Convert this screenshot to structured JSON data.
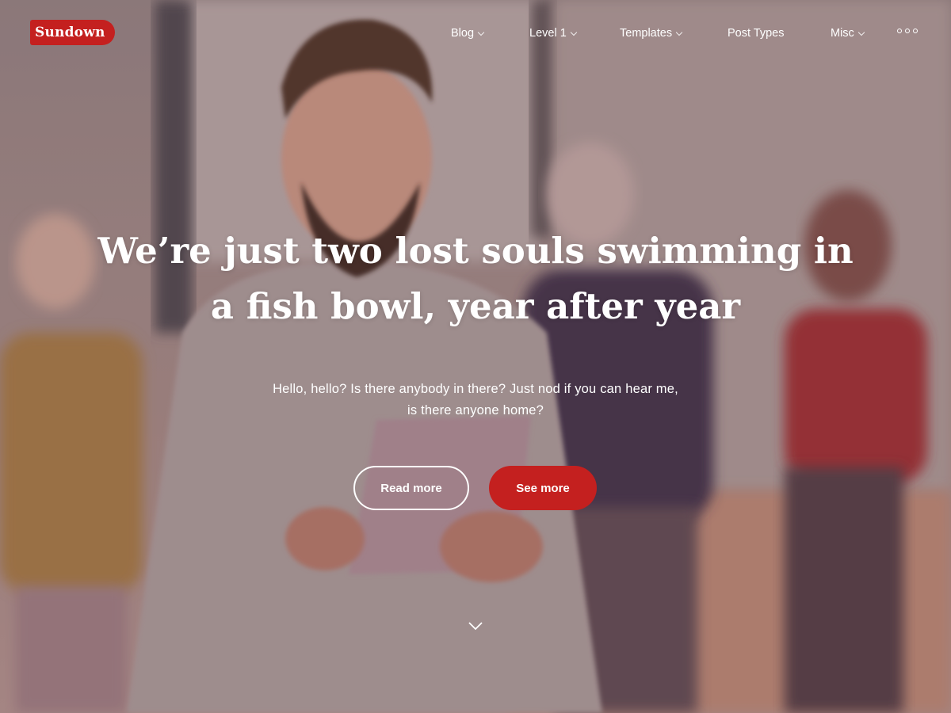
{
  "brand": {
    "name": "Sundown",
    "accent_color": "#c4201f"
  },
  "nav": {
    "items": [
      {
        "label": "Blog",
        "has_dropdown": true
      },
      {
        "label": "Level 1",
        "has_dropdown": true
      },
      {
        "label": "Templates",
        "has_dropdown": true
      },
      {
        "label": "Post Types",
        "has_dropdown": false
      },
      {
        "label": "Misc",
        "has_dropdown": true
      }
    ],
    "more_icon": "more-dots-icon"
  },
  "hero": {
    "headline_line1": "We’re just two lost souls swimming in",
    "headline_line2": "a fish bowl, year after year",
    "subtext_line1": "Hello, hello? Is there anybody in there? Just nod if you can hear me,",
    "subtext_line2": "is there anyone home?",
    "primary_button": "Read more",
    "secondary_button": "See more",
    "scroll_icon": "chevron-down-icon"
  }
}
